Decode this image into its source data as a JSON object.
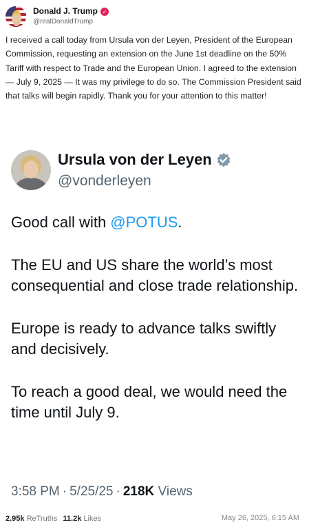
{
  "post": {
    "author": {
      "name": "Donald J. Trump",
      "handle": "@realDonaldTrump"
    },
    "text": "I received a call today from Ursula von der Leyen, President of the European Commission, requesting an extension on the June 1st deadline on the 50% Tariff with respect to Trade and the European Union. I agreed to the extension — July 9, 2025 — It was my privilege to do so. The Commission President said that talks will begin rapidly. Thank you for your attention to this matter!"
  },
  "tweet": {
    "name": "Ursula von der Leyen",
    "handle": "@vonderleyen",
    "line1_prefix": "Good call with ",
    "line1_mention": "@POTUS",
    "line1_suffix": ".",
    "para2": "The EU and US share the world’s most consequential and close trade relationship.",
    "para3": "Europe is ready to advance talks swiftly and decisively.",
    "para4": "To reach a good deal, we would need the time until July 9.",
    "time": "3:58 PM",
    "date": "5/25/25",
    "views_count": "218K",
    "views_label": "Views"
  },
  "footer": {
    "retruths_count": "2.95k",
    "retruths_label": "ReTruths",
    "likes_count": "11.2k",
    "likes_label": "Likes",
    "timestamp": "May 26, 2025, 6:15 AM"
  },
  "colors": {
    "mention": "#1d9bf0",
    "verified": "#e0245e",
    "gov_badge": "#829aab"
  }
}
